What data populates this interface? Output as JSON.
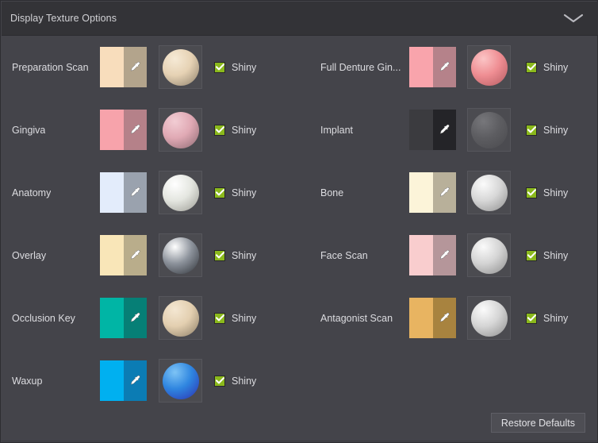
{
  "header": {
    "title": "Display Texture Options",
    "collapse_icon": "chevron-down-icon"
  },
  "swatch_icon": "eyedropper-icon",
  "checkbox_icon": "check-icon",
  "columns": [
    {
      "name": "left",
      "rows": [
        {
          "label": "Preparation Scan",
          "color_light": "#f8ddbc",
          "color_dark": "#b3a48c",
          "sphere_base": "#e6d2b4",
          "sphere_highlight": "#f6ead6",
          "sphere_shadow": "#8c7f6b",
          "shiny_label": "Shiny",
          "shiny_checked": true
        },
        {
          "label": "Gingiva",
          "color_light": "#f7a3ab",
          "color_dark": "#b58189",
          "sphere_base": "#e0a9b4",
          "sphere_highlight": "#f2cdd4",
          "sphere_shadow": "#8d6a72",
          "shiny_label": "Shiny",
          "shiny_checked": true
        },
        {
          "label": "Anatomy",
          "color_light": "#e3ecfb",
          "color_dark": "#9aa2ae",
          "sphere_base": "#e4e6e0",
          "sphere_highlight": "#ffffff",
          "sphere_shadow": "#9a9a93",
          "shiny_label": "Shiny",
          "shiny_checked": true
        },
        {
          "label": "Overlay",
          "color_light": "#f9e6b8",
          "color_dark": "#b9ad8b",
          "sphere_base": "#8d939c",
          "sphere_highlight": "#ffffff",
          "sphere_shadow": "#2e3238",
          "shiny_label": "Shiny",
          "shiny_checked": true
        },
        {
          "label": "Occlusion Key",
          "color_light": "#00b5a5",
          "color_dark": "#067f76",
          "sphere_base": "#e3cfb0",
          "sphere_highlight": "#f4e7d2",
          "sphere_shadow": "#8b7d66",
          "shiny_label": "Shiny",
          "shiny_checked": true
        },
        {
          "label": "Waxup",
          "color_light": "#00b0f0",
          "color_dark": "#0b7cb4",
          "sphere_base": "#2f86e0",
          "sphere_highlight": "#7ec4f5",
          "sphere_shadow": "#2c2fb0",
          "shiny_label": "Shiny",
          "shiny_checked": true
        }
      ]
    },
    {
      "name": "right",
      "rows": [
        {
          "label": "Full Denture Gin...",
          "color_light": "#f9a4ac",
          "color_dark": "#b5828a",
          "sphere_base": "#ef8e93",
          "sphere_highlight": "#fbc5c6",
          "sphere_shadow": "#b35a60",
          "shiny_label": "Shiny",
          "shiny_checked": true
        },
        {
          "label": "Implant",
          "color_light": "#3b3b3f",
          "color_dark": "#242428",
          "sphere_base": "#5d5d61",
          "sphere_highlight": "#77777b",
          "sphere_shadow": "#4a4a4e",
          "shiny_label": "Shiny",
          "shiny_checked": true
        },
        {
          "label": "Bone",
          "color_light": "#fcf4d9",
          "color_dark": "#b8b09a",
          "sphere_base": "#d7d7d7",
          "sphere_highlight": "#fbfbfb",
          "sphere_shadow": "#8e8e8e",
          "shiny_label": "Shiny",
          "shiny_checked": true
        },
        {
          "label": "Face Scan",
          "color_light": "#f9cdce",
          "color_dark": "#b5969a",
          "sphere_base": "#d4d4d4",
          "sphere_highlight": "#fafafa",
          "sphere_shadow": "#8c8c8c",
          "shiny_label": "Shiny",
          "shiny_checked": true
        },
        {
          "label": "Antagonist Scan",
          "color_light": "#e8b461",
          "color_dark": "#a8833f",
          "sphere_base": "#d5d5d5",
          "sphere_highlight": "#fbfbfb",
          "sphere_shadow": "#8d8d8d",
          "shiny_label": "Shiny",
          "shiny_checked": true
        }
      ]
    }
  ],
  "footer": {
    "restore_defaults_label": "Restore Defaults"
  },
  "colors": {
    "panel_bg": "#44444a",
    "header_bg": "#333337",
    "text": "#dcdce0",
    "checkbox_green": "#8bb91c",
    "button_bg": "#4e4e54"
  }
}
